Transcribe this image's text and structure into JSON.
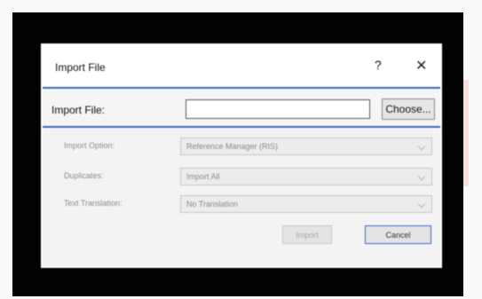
{
  "dialog": {
    "title": "Import File",
    "help_label": "?",
    "close_label": "✕"
  },
  "import_file": {
    "label": "Import File:",
    "value": "",
    "choose_label": "Choose..."
  },
  "options": [
    {
      "label": "Import Option:",
      "value": "Reference Manager (RIS)"
    },
    {
      "label": "Duplicates:",
      "value": "Import All"
    },
    {
      "label": "Text Translation:",
      "value": "No Translation"
    }
  ],
  "buttons": {
    "import_label": "Import",
    "cancel_label": "Cancel"
  },
  "icons": {
    "help": "question-icon",
    "close": "close-icon",
    "dropdown": "chevron-down-icon"
  },
  "colors": {
    "accent": "#3b6ab6",
    "frame": "#020202"
  }
}
